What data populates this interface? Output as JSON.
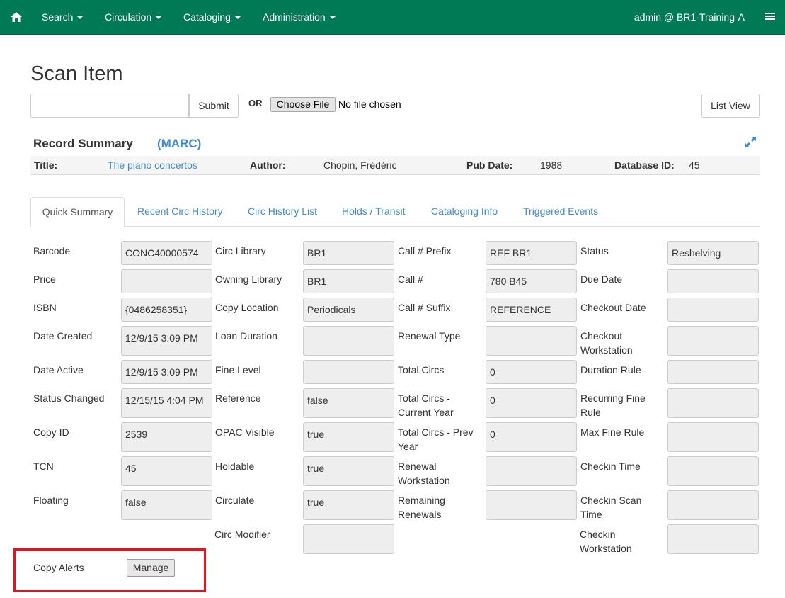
{
  "nav": {
    "menus": [
      "Search",
      "Circulation",
      "Cataloging",
      "Administration"
    ],
    "user": "admin @ BR1-Training-A"
  },
  "page": {
    "title": "Scan Item",
    "submit": "Submit",
    "or": "OR",
    "choose_file": "Choose File",
    "no_file": "No file chosen",
    "list_view": "List View"
  },
  "record": {
    "heading": "Record Summary",
    "marc": "(MARC)",
    "title_label": "Title:",
    "title": "The piano concertos",
    "author_label": "Author:",
    "author": "Chopin, Frédéric",
    "pubdate_label": "Pub Date:",
    "pubdate": "1988",
    "dbid_label": "Database ID:",
    "dbid": "45"
  },
  "tabs": [
    "Quick Summary",
    "Recent Circ History",
    "Circ History List",
    "Holds / Transit",
    "Cataloging Info",
    "Triggered Events"
  ],
  "fields": {
    "col1": [
      {
        "label": "Barcode",
        "value": "CONC40000574"
      },
      {
        "label": "Price",
        "value": ""
      },
      {
        "label": "ISBN",
        "value": "{0486258351}"
      },
      {
        "label": "Date Created",
        "value": "12/9/15 3:09 PM"
      },
      {
        "label": "Date Active",
        "value": "12/9/15 3:09 PM"
      },
      {
        "label": "Status Changed",
        "value": "12/15/15 4:04 PM"
      },
      {
        "label": "Copy ID",
        "value": "2539"
      },
      {
        "label": "TCN",
        "value": "45"
      },
      {
        "label": "Floating",
        "value": "false"
      }
    ],
    "col2": [
      {
        "label": "Circ Library",
        "value": "BR1"
      },
      {
        "label": "Owning Library",
        "value": "BR1"
      },
      {
        "label": "Copy Location",
        "value": "Periodicals"
      },
      {
        "label": "Loan Duration",
        "value": ""
      },
      {
        "label": "Fine Level",
        "value": ""
      },
      {
        "label": "Reference",
        "value": "false"
      },
      {
        "label": "OPAC Visible",
        "value": "true"
      },
      {
        "label": "Holdable",
        "value": "true"
      },
      {
        "label": "Circulate",
        "value": "true"
      },
      {
        "label": "Circ Modifier",
        "value": ""
      }
    ],
    "col3": [
      {
        "label": "Call # Prefix",
        "value": "REF BR1"
      },
      {
        "label": "Call #",
        "value": "780 B45"
      },
      {
        "label": "Call # Suffix",
        "value": "REFERENCE"
      },
      {
        "label": "Renewal Type",
        "value": ""
      },
      {
        "label": "Total Circs",
        "value": "0"
      },
      {
        "label": "Total Circs - Current Year",
        "value": "0"
      },
      {
        "label": "Total Circs - Prev Year",
        "value": "0"
      },
      {
        "label": "Renewal Workstation",
        "value": ""
      },
      {
        "label": "Remaining Renewals",
        "value": ""
      }
    ],
    "col4": [
      {
        "label": "Status",
        "value": "Reshelving"
      },
      {
        "label": "Due Date",
        "value": ""
      },
      {
        "label": "Checkout Date",
        "value": ""
      },
      {
        "label": "Checkout Workstation",
        "value": ""
      },
      {
        "label": "Duration Rule",
        "value": ""
      },
      {
        "label": "Recurring Fine Rule",
        "value": ""
      },
      {
        "label": "Max Fine Rule",
        "value": ""
      },
      {
        "label": "Checkin Time",
        "value": ""
      },
      {
        "label": "Checkin Scan Time",
        "value": ""
      },
      {
        "label": "Checkin Workstation",
        "value": ""
      }
    ]
  },
  "copy_alerts": {
    "label": "Copy Alerts",
    "button": "Manage"
  }
}
